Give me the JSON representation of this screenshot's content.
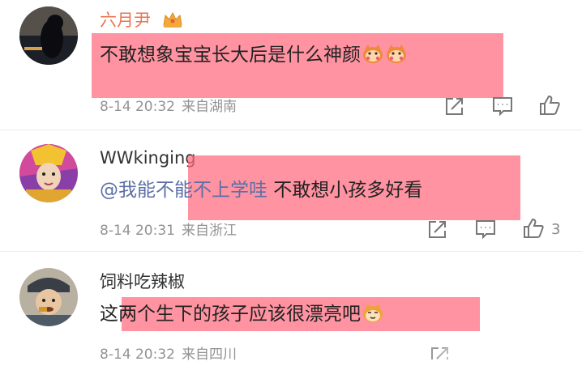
{
  "comments": [
    {
      "user": "六月尹",
      "text": "不敢想象宝宝长大后是什么神颜",
      "emojis": [
        "doge-flower-emoji",
        "doge-flower-emoji"
      ],
      "time": "8-14 20:32",
      "location": "来自湖南",
      "likes": ""
    },
    {
      "user": "WWkinging",
      "mention": "@我能不能不上学哇",
      "text": " 不敢想小孩多好看",
      "time": "8-14 20:31",
      "location": "来自浙江",
      "likes": "3"
    },
    {
      "user": "饲料吃辣椒",
      "text": "这两个生下的孩子应该很漂亮吧",
      "emojis": [
        "doge-emoji"
      ],
      "time": "8-14 20:32",
      "location": "来自四川",
      "likes": ""
    }
  ],
  "colors": {
    "vip_name": "#eb7350",
    "mention": "#5d6fa6",
    "meta": "#939393",
    "highlight": "rgba(255,105,125,0.72)"
  },
  "icons": [
    "crown-badge-icon",
    "repost-icon",
    "comment-icon",
    "like-icon"
  ]
}
